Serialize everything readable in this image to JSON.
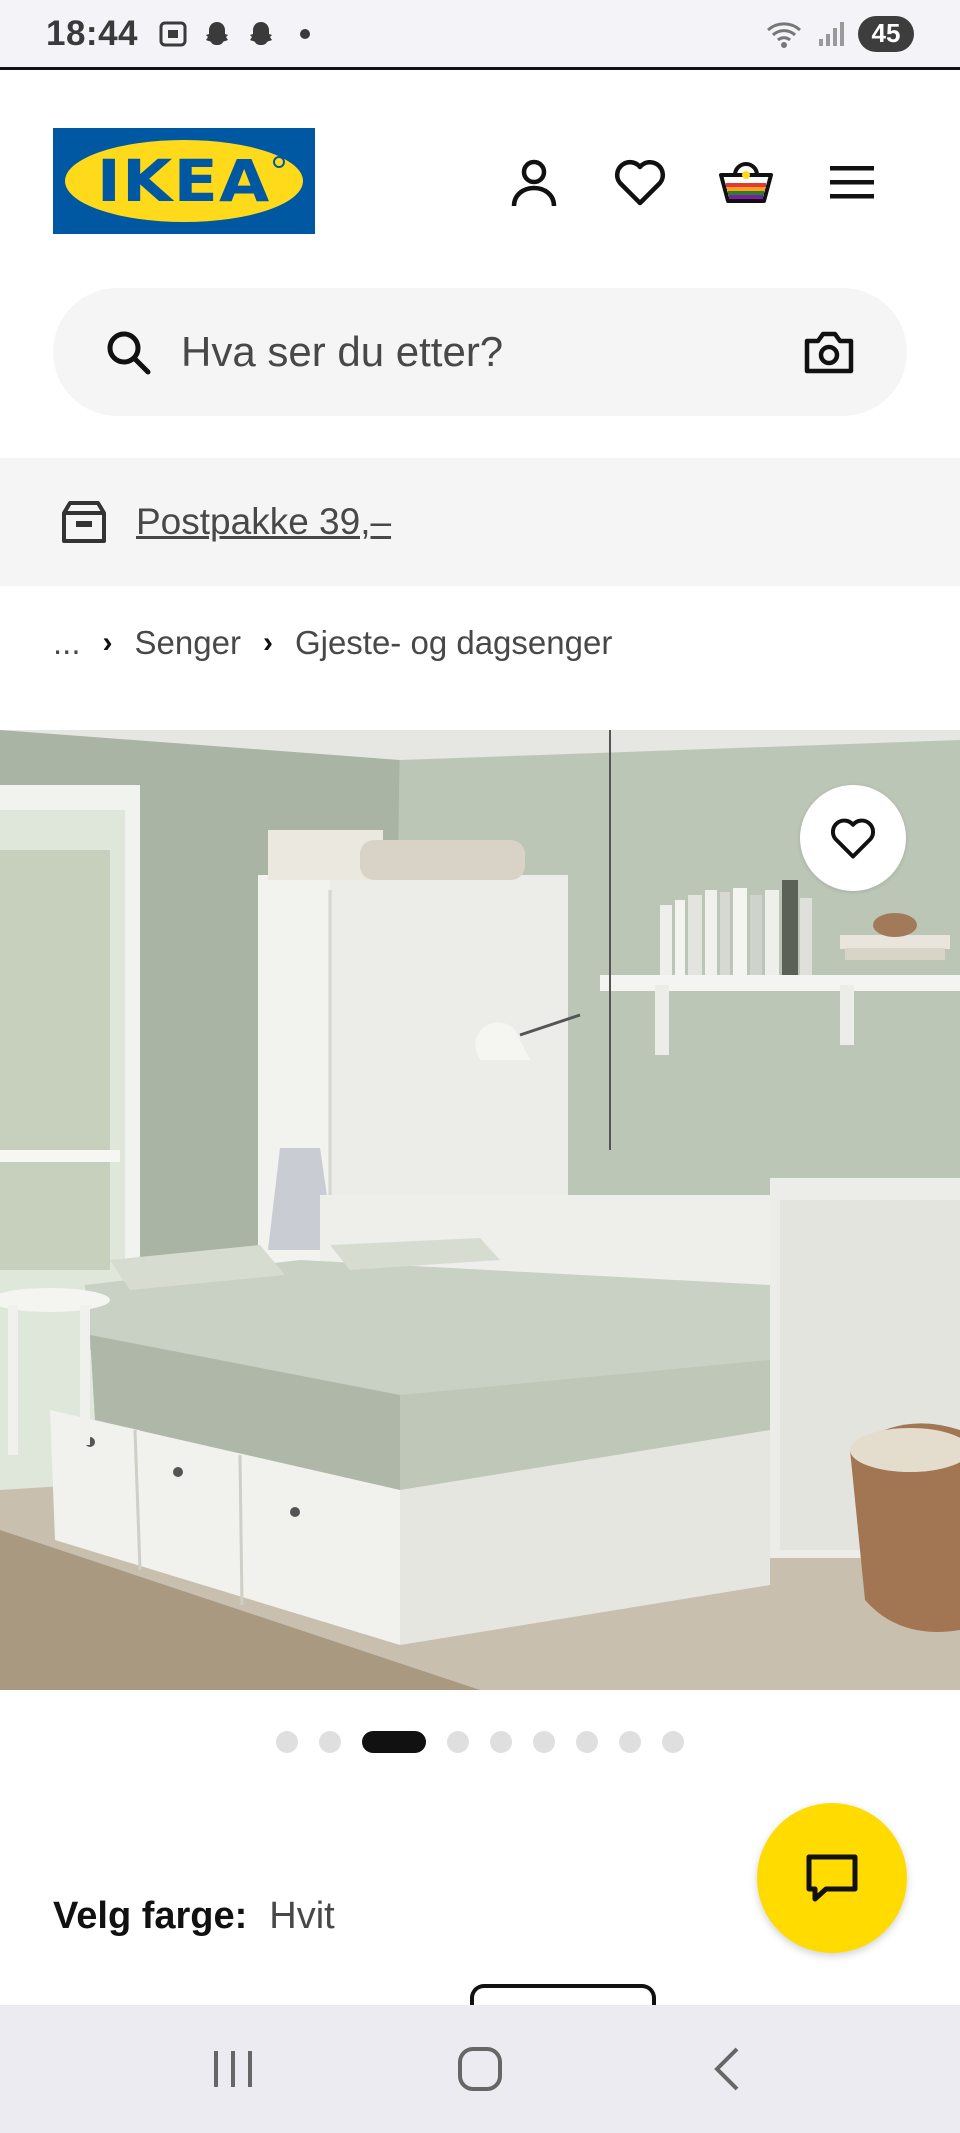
{
  "status_bar": {
    "time": "18:44",
    "battery": "45",
    "left_icons": [
      "screenshot-icon",
      "snapchat-icon",
      "snapchat-icon",
      "dot-icon"
    ],
    "right_icons": [
      "wifi-icon",
      "signal-icon"
    ]
  },
  "header": {
    "logo_text": "IKEA",
    "icons": [
      "account-icon",
      "heart-icon",
      "basket-icon",
      "menu-icon"
    ]
  },
  "search": {
    "placeholder": "Hva ser du etter?",
    "icons": [
      "search-icon",
      "camera-icon"
    ]
  },
  "promo": {
    "text": "Postpakke 39,–",
    "icon": "box-icon"
  },
  "breadcrumb": {
    "items": [
      "...",
      "Senger",
      "Gjeste- og dagsenger"
    ]
  },
  "gallery": {
    "image_count": 9,
    "active_index": 2
  },
  "color_select": {
    "label": "Velg farge:",
    "value": "Hvit"
  },
  "colors": {
    "ikea_blue": "#0058a3",
    "ikea_yellow": "#ffda1a",
    "chat_yellow": "#ffdb00"
  },
  "nav_bar": {
    "icons": [
      "recents-icon",
      "home-icon",
      "back-icon"
    ]
  }
}
